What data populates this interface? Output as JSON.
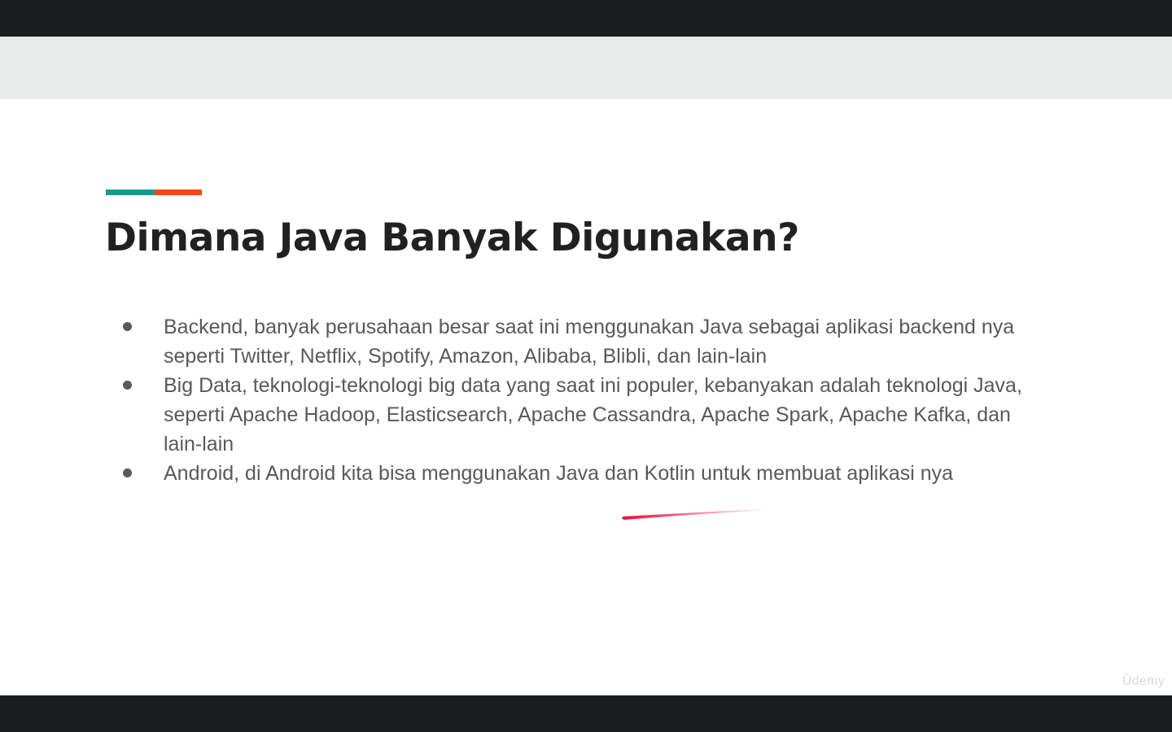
{
  "slide": {
    "title": "Dimana Java Banyak Digunakan?",
    "accent_colors": {
      "teal": "#119c8c",
      "orange": "#ef4b14"
    },
    "bullets": [
      "Backend, banyak perusahaan besar saat ini menggunakan Java sebagai aplikasi backend nya seperti Twitter, Netflix, Spotify, Amazon, Alibaba, Blibli, dan lain-lain",
      "Big Data, teknologi-teknologi big data yang saat ini populer, kebanyakan adalah teknologi Java, seperti Apache Hadoop, Elasticsearch, Apache Cassandra, Apache Spark, Apache Kafka, dan lain-lain",
      "Android, di Android kita bisa menggunakan Java dan Kotlin untuk membuat aplikasi nya"
    ],
    "annotation_color": "#e8093a"
  },
  "watermark": {
    "text": "Ūdemy"
  }
}
